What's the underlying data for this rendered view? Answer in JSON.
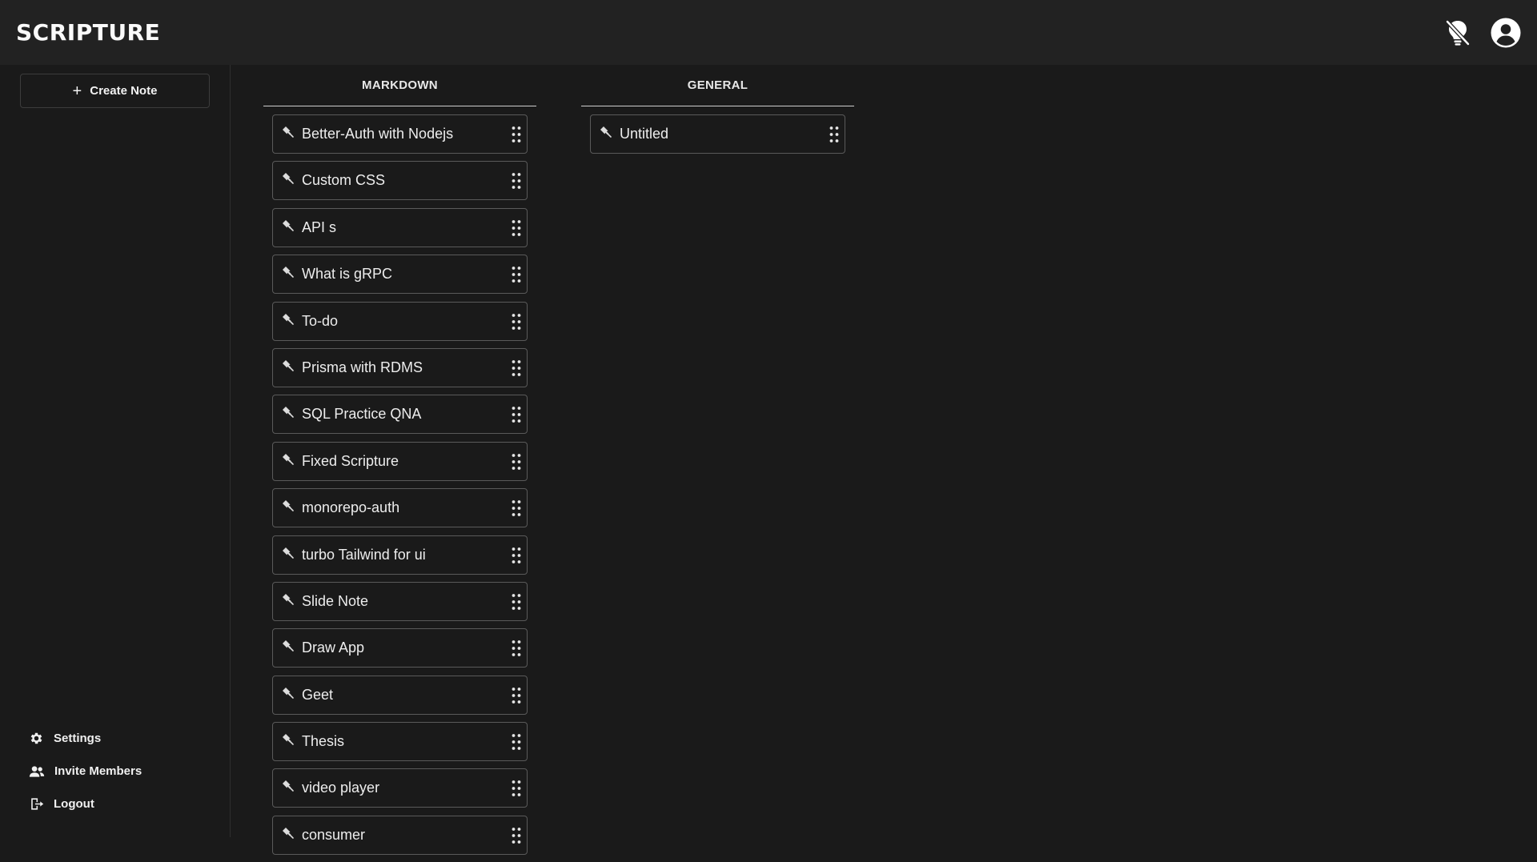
{
  "app": {
    "title": "SCRIPTURE"
  },
  "header": {
    "icons": [
      "lightbulb-off-icon",
      "user-circle-icon"
    ]
  },
  "sidebar": {
    "create_label": "Create Note",
    "bottom_items": [
      {
        "label": "Settings",
        "icon": "gear-icon"
      },
      {
        "label": "Invite Members",
        "icon": "users-icon"
      },
      {
        "label": "Logout",
        "icon": "logout-icon"
      }
    ]
  },
  "columns": [
    {
      "title": "MARKDOWN",
      "notes": [
        "Better-Auth with Nodejs",
        "Custom CSS",
        "API s",
        "What is gRPC",
        "To-do",
        "Prisma with RDMS",
        "SQL Practice QNA",
        "Fixed Scripture",
        "monorepo-auth",
        "turbo Tailwind for ui",
        "Slide Note",
        "Draw App",
        "Geet",
        "Thesis",
        "video player",
        "consumer"
      ]
    },
    {
      "title": "GENERAL",
      "notes": [
        "Untitled"
      ]
    }
  ],
  "colors": {
    "background": "#1a1a1a",
    "header": "#222222",
    "card_border": "#5a5a5a",
    "text": "#ededed"
  }
}
